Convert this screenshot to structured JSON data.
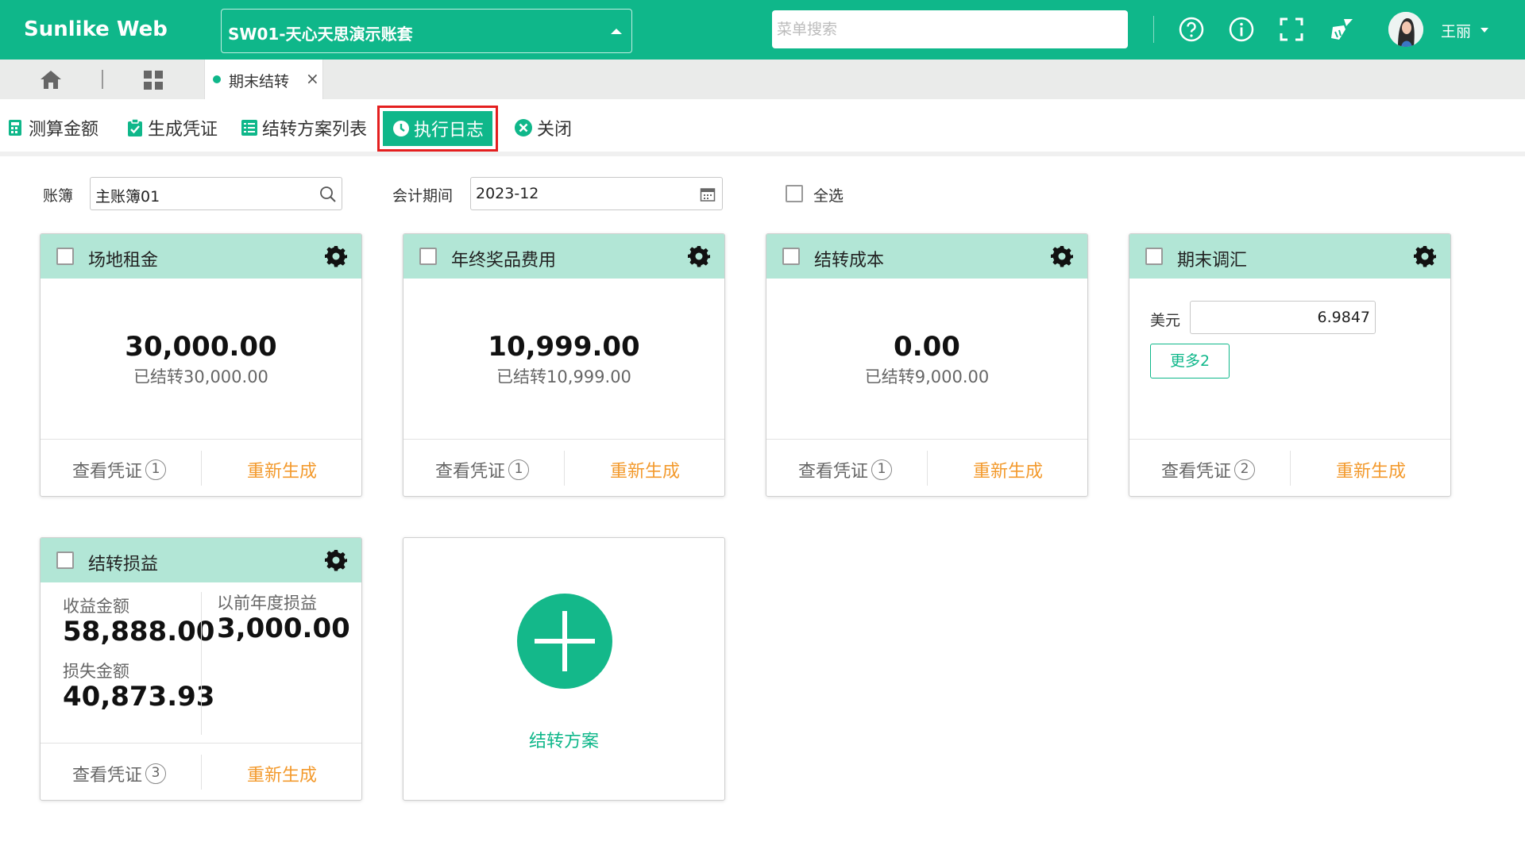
{
  "header": {
    "brand": "Sunlike Web",
    "account": "SW01-天心天思演示账套",
    "search_placeholder": "菜单搜索",
    "user_name": "王丽",
    "icons": [
      "help-circle-icon",
      "info-circle-icon",
      "fullscreen-icon",
      "clean-broom-icon"
    ]
  },
  "tabs": {
    "active_label": "期末结转",
    "close_glyph": "×"
  },
  "toolbar": {
    "calc_label": "测算金额",
    "gen_voucher_label": "生成凭证",
    "plan_list_label": "结转方案列表",
    "exec_log_label": "执行日志",
    "close_label": "关闭"
  },
  "filters": {
    "ledger_label": "账簿",
    "ledger_value": "主账簿01",
    "period_label": "会计期间",
    "period_value": "2023-12",
    "select_all_label": "全选"
  },
  "cards": [
    {
      "title": "场地租金",
      "amount": "30,000.00",
      "sub": "已结转30,000.00",
      "view_label": "查看凭证",
      "count": "1",
      "regen_label": "重新生成"
    },
    {
      "title": "年终奖品费用",
      "amount": "10,999.00",
      "sub": "已结转10,999.00",
      "view_label": "查看凭证",
      "count": "1",
      "regen_label": "重新生成"
    },
    {
      "title": "结转成本",
      "amount": "0.00",
      "sub": "已结转9,000.00",
      "view_label": "查看凭证",
      "count": "1",
      "regen_label": "重新生成"
    },
    {
      "title": "期末调汇",
      "fx_label": "美元",
      "fx_value": "6.9847",
      "more_label": "更多2",
      "view_label": "查看凭证",
      "count": "2",
      "regen_label": "重新生成"
    },
    {
      "title": "结转损益",
      "income_label": "收益金额",
      "income_value": "58,888.00",
      "loss_label": "损失金额",
      "loss_value": "40,873.93",
      "prior_label": "以前年度损益",
      "prior_value": "3,000.00",
      "view_label": "查看凭证",
      "count": "3",
      "regen_label": "重新生成"
    }
  ],
  "add_card": {
    "label": "结转方案"
  },
  "colors": {
    "brand": "#0fb78a",
    "card_header": "#b2e6d6",
    "regen": "#f39a2d",
    "highlight_border": "#e41f1f"
  }
}
